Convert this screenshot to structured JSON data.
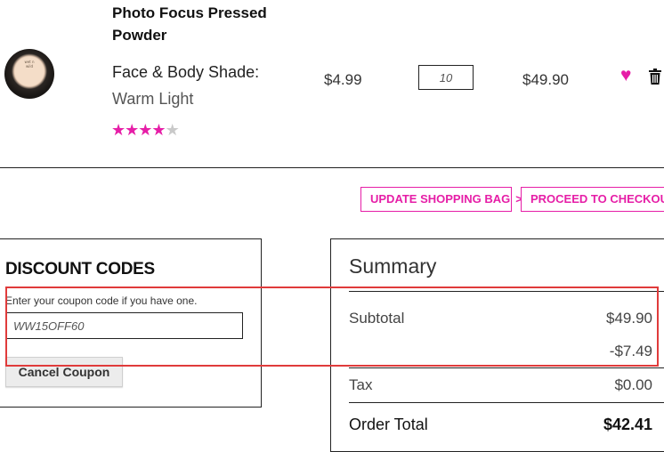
{
  "product": {
    "name": "Photo Focus Pressed Powder",
    "shade_label": "Face & Body Shade:",
    "shade_value": "Warm Light",
    "rating": 4,
    "rating_max": 5,
    "price": "$4.99",
    "quantity": "10",
    "line_total": "$49.90",
    "thumb_logo_text": "wet n wild"
  },
  "actions": {
    "update_label": "UPDATE SHOPPING BAG",
    "checkout_label": "PROCEED TO CHECKOUT",
    "chevron": ">"
  },
  "discount": {
    "title": "DISCOUNT CODES",
    "help_text": "Enter your coupon code if you have one.",
    "coupon_value": "WW15OFF60",
    "cancel_label": "Cancel Coupon"
  },
  "summary": {
    "title": "Summary",
    "subtotal_label": "Subtotal",
    "subtotal_value": "$49.90",
    "discount_value": "-$7.49",
    "tax_label": "Tax",
    "tax_value": "$0.00",
    "total_label": "Order Total",
    "total_value": "$42.41"
  },
  "colors": {
    "accent": "#e61ea7",
    "highlight": "#e03b3b"
  },
  "icons": [
    "heart-icon",
    "trash-icon",
    "star-icon",
    "chevron-right-icon"
  ]
}
